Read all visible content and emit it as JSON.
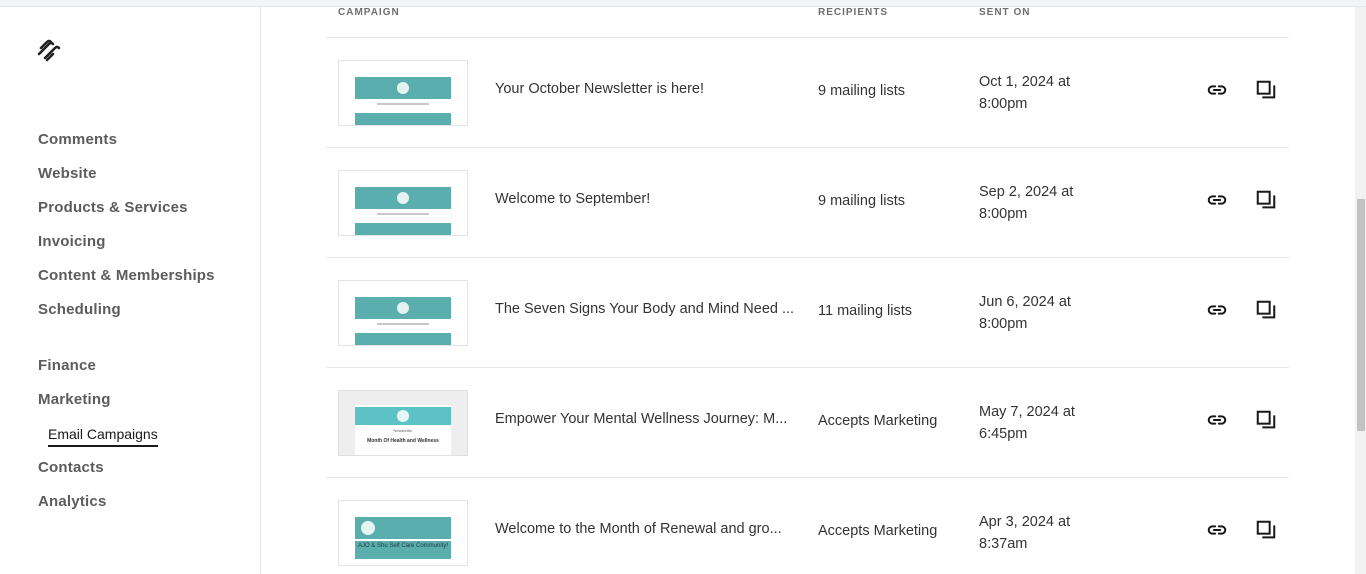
{
  "sidebar": {
    "logo": "squarespace-logo",
    "items": [
      {
        "label": "Comments"
      },
      {
        "label": "Website"
      },
      {
        "label": "Products & Services"
      },
      {
        "label": "Invoicing"
      },
      {
        "label": "Content & Memberships"
      },
      {
        "label": "Scheduling"
      },
      {
        "label": "Finance"
      },
      {
        "label": "Marketing"
      },
      {
        "label": "Email Campaigns",
        "active": true
      },
      {
        "label": "Contacts"
      },
      {
        "label": "Analytics"
      }
    ]
  },
  "table": {
    "columns": [
      "CAMPAIGN",
      "RECIPIENTS",
      "SENT ON"
    ],
    "rows": [
      {
        "title": "Your October Newsletter is here!",
        "recipients": "9 mailing lists",
        "sent_date": "Oct 1, 2024 at",
        "sent_time": "8:00pm"
      },
      {
        "title": "Welcome to September!",
        "recipients": "9 mailing lists",
        "sent_date": "Sep 2, 2024 at",
        "sent_time": "8:00pm"
      },
      {
        "title": "The Seven Signs Your Body and Mind Need ...",
        "recipients": "11 mailing lists",
        "sent_date": "Jun 6, 2024 at",
        "sent_time": "8:00pm"
      },
      {
        "title": "Empower Your Mental Wellness Journey: M...",
        "recipients": "Accepts Marketing",
        "sent_date": "May 7, 2024 at",
        "sent_time": "6:45pm",
        "thumb_title": "Month Of Health and Wellness",
        "thumb_sub": "Newsletter"
      },
      {
        "title": "Welcome to the Month of Renewal and gro...",
        "recipients": "Accepts Marketing",
        "sent_date": "Apr 3, 2024 at",
        "sent_time": "8:37am",
        "thumb_title": "AJO & Shu Self Care Community!"
      }
    ]
  },
  "icons": {
    "copy_link": "link-icon",
    "duplicate": "duplicate-icon"
  },
  "colors": {
    "thumb_accent": "#5aaeae",
    "nav_text": "#5c5c5c",
    "active_underline": "#1a1a1a"
  }
}
